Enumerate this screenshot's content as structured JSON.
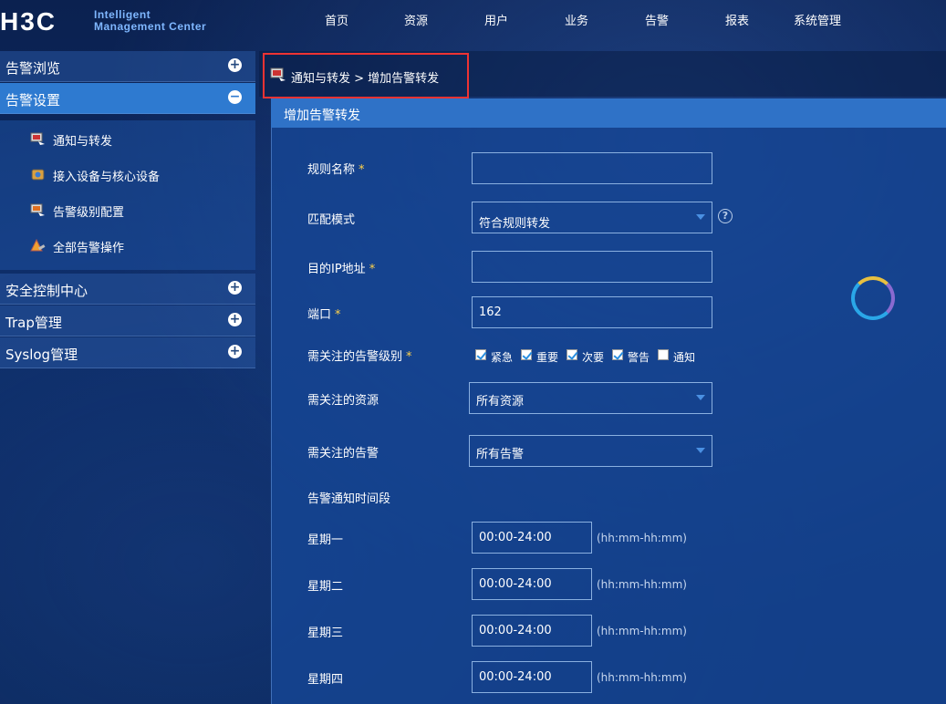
{
  "logo": {
    "brand": "H3C",
    "line1": "Intelligent",
    "line2": "Management Center"
  },
  "nav": [
    "首页",
    "资源",
    "用户",
    "业务",
    "告警",
    "报表",
    "系统管理"
  ],
  "sidebar": {
    "sections": [
      {
        "label": "告警浏览",
        "toggle": "+"
      },
      {
        "label": "告警设置",
        "toggle": "−"
      },
      {
        "label": "安全控制中心",
        "toggle": "+"
      },
      {
        "label": "Trap管理",
        "toggle": "+"
      },
      {
        "label": "Syslog管理",
        "toggle": "+"
      }
    ],
    "items": [
      {
        "label": "通知与转发",
        "icon": "notify-forward-icon"
      },
      {
        "label": "接入设备与核心设备",
        "icon": "device-icon"
      },
      {
        "label": "告警级别配置",
        "icon": "alarm-level-icon"
      },
      {
        "label": "全部告警操作",
        "icon": "alarm-operation-icon"
      }
    ]
  },
  "breadcrumb": {
    "text": "通知与转发 > 增加告警转发"
  },
  "panel": {
    "title": "增加告警转发"
  },
  "form": {
    "rule_name": {
      "label": "规则名称",
      "value": ""
    },
    "match_mode": {
      "label": "匹配模式",
      "value": "符合规则转发"
    },
    "dest_ip": {
      "label": "目的IP地址",
      "value": ""
    },
    "port": {
      "label": "端口",
      "value": "162"
    },
    "levels": {
      "label": "需关注的告警级别",
      "options": [
        {
          "label": "紧急",
          "checked": true
        },
        {
          "label": "重要",
          "checked": true
        },
        {
          "label": "次要",
          "checked": true
        },
        {
          "label": "警告",
          "checked": true
        },
        {
          "label": "通知",
          "checked": false
        }
      ]
    },
    "resources": {
      "label": "需关注的资源",
      "value": "所有资源"
    },
    "alarms": {
      "label": "需关注的告警",
      "value": "所有告警"
    },
    "time_period": {
      "label": "告警通知时间段"
    },
    "days": [
      {
        "label": "星期一",
        "value": "00:00-24:00"
      },
      {
        "label": "星期二",
        "value": "00:00-24:00"
      },
      {
        "label": "星期三",
        "value": "00:00-24:00"
      },
      {
        "label": "星期四",
        "value": "00:00-24:00"
      }
    ],
    "time_format": "(hh:mm-hh:mm)",
    "required_mark": "*"
  },
  "colors": {
    "accent": "#2f72c7",
    "highlight_border": "#e33333",
    "required": "#ffd24a"
  }
}
